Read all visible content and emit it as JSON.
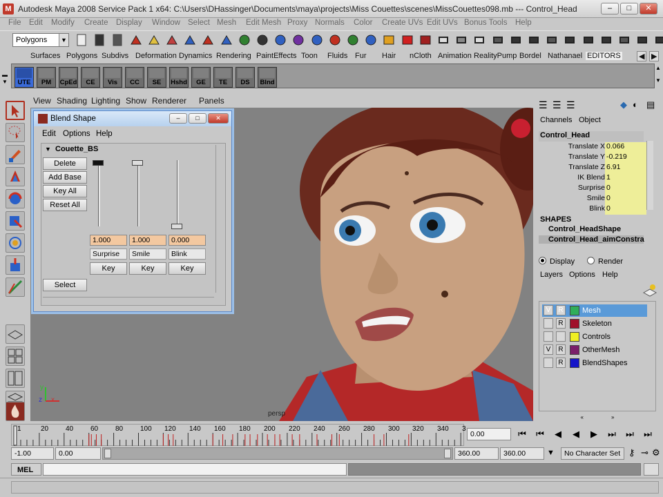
{
  "window": {
    "app_icon": "maya-logo-icon",
    "title": "Autodesk Maya 2008 Service Pack 1 x64: C:\\Users\\DHassinger\\Documents\\maya\\projects\\Miss Couettes\\scenes\\MissCouettes098.mb   ---   Control_Head"
  },
  "menubar": [
    "File",
    "Edit",
    "Modify",
    "Create",
    "Display",
    "Window",
    "Select",
    "Mesh",
    "Edit Mesh",
    "Proxy",
    "Normals",
    "Color",
    "Create UVs",
    "Edit UVs",
    "Bonus Tools",
    "Help"
  ],
  "toolbar": {
    "mode": "Polygons"
  },
  "shelf_tabs": [
    "Surfaces",
    "Polygons",
    "Subdivs",
    "Deformation",
    "Dynamics",
    "Rendering",
    "PaintEffects",
    "Toon",
    "Fluids",
    "Fur",
    "Hair",
    "nCloth",
    "Animation",
    "RealityPump",
    "Bordel",
    "Nathanael",
    "EDITORS"
  ],
  "shelf_buttons": [
    "UTE",
    "PM",
    "CpEd",
    "CE",
    "Vis",
    "CC",
    "SE",
    "Hshd",
    "GE",
    "TE",
    "DS",
    "Blnd"
  ],
  "panel_menu": [
    "View",
    "Shading",
    "Lighting",
    "Show",
    "Renderer",
    "Panels"
  ],
  "viewport": {
    "camera_label": "persp"
  },
  "blend_dialog": {
    "title": "Blend Shape",
    "menu": [
      "Edit",
      "Options",
      "Help"
    ],
    "node": "Couette_BS",
    "buttons": [
      "Delete",
      "Add Base",
      "Key All",
      "Reset All",
      "Select"
    ],
    "targets": [
      {
        "value": "1.000",
        "name": "Surprise",
        "key": "Key"
      },
      {
        "value": "1.000",
        "name": "Smile",
        "key": "Key"
      },
      {
        "value": "0.000",
        "name": "Blink",
        "key": "Key"
      }
    ]
  },
  "channel_box": {
    "tabs": [
      "Channels",
      "Object"
    ],
    "node": "Control_Head",
    "attrs": [
      {
        "name": "Translate X",
        "value": "0.066"
      },
      {
        "name": "Translate Y",
        "value": "-0.219"
      },
      {
        "name": "Translate Z",
        "value": "6.91"
      },
      {
        "name": "IK Blend",
        "value": "1"
      },
      {
        "name": "Surprise",
        "value": "0"
      },
      {
        "name": "Smile",
        "value": "0"
      },
      {
        "name": "Blink",
        "value": "0"
      }
    ],
    "shapes_header": "SHAPES",
    "shapes": [
      "Control_HeadShape",
      "Control_Head_aimConstra"
    ]
  },
  "layer_editor": {
    "display_label": "Display",
    "render_label": "Render",
    "menu": [
      "Layers",
      "Options",
      "Help"
    ],
    "layers": [
      {
        "v": "V",
        "r": "R",
        "name": "Mesh",
        "color": "#2fae5a",
        "selected": true
      },
      {
        "v": "",
        "r": "R",
        "name": "Skeleton",
        "color": "#a0102a",
        "selected": false
      },
      {
        "v": "",
        "r": "",
        "name": "Controls",
        "color": "#eeee22",
        "selected": false
      },
      {
        "v": "V",
        "r": "R",
        "name": "OtherMesh",
        "color": "#7a1f6a",
        "selected": false
      },
      {
        "v": "",
        "r": "R",
        "name": "BlendShapes",
        "color": "#1515c8",
        "selected": false
      }
    ]
  },
  "timeline": {
    "ticks": [
      "1",
      "20",
      "40",
      "60",
      "80",
      "100",
      "120",
      "140",
      "160",
      "180",
      "200",
      "220",
      "240",
      "260",
      "280",
      "300",
      "320",
      "340",
      "3"
    ],
    "current_time": "0.00"
  },
  "range": {
    "start": "-1.00",
    "current": "0.00",
    "end": "360.00",
    "range_end": "360.00",
    "character_set": "No Character Set"
  },
  "command": {
    "label": "MEL"
  },
  "colors": {
    "ui_gray": "#c8c8c8",
    "viewport_gray": "#828282",
    "selected_blue": "#5a9ad8"
  }
}
